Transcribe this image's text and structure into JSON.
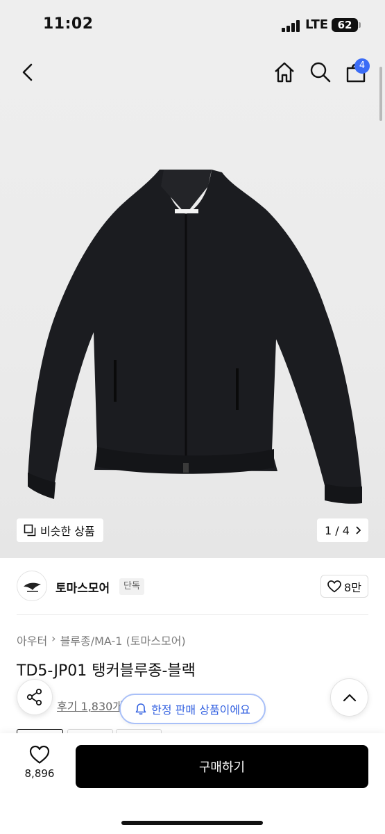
{
  "status_bar": {
    "time": "11:02",
    "network": "LTE",
    "battery": "62"
  },
  "header": {
    "cart_count": "4"
  },
  "gallery": {
    "similar_label": "비슷한 상품",
    "page_indicator": "1 / 4"
  },
  "brand": {
    "name": "토마스모어",
    "badge": "단독",
    "likes": "8만"
  },
  "breadcrumb": [
    "아우터",
    "블루종/MA-1 (토마스모어)"
  ],
  "product": {
    "title": "TD5-JP01 탱커블루종-블랙",
    "review_text": "후기 1,830개",
    "limited_notice": "한정 판매 상품이에요"
  },
  "bottom": {
    "wish_count": "8,896",
    "buy_label": "구매하기"
  },
  "colors": {
    "accent": "#3b6cf6",
    "notice_text": "#2f5ee0",
    "buy_bg": "#000000"
  },
  "icons": [
    "back-icon",
    "home-icon",
    "search-icon",
    "cart-icon",
    "similar-icon",
    "chevron-right-icon",
    "heart-icon",
    "share-icon",
    "bell-icon",
    "chevron-up-icon"
  ]
}
